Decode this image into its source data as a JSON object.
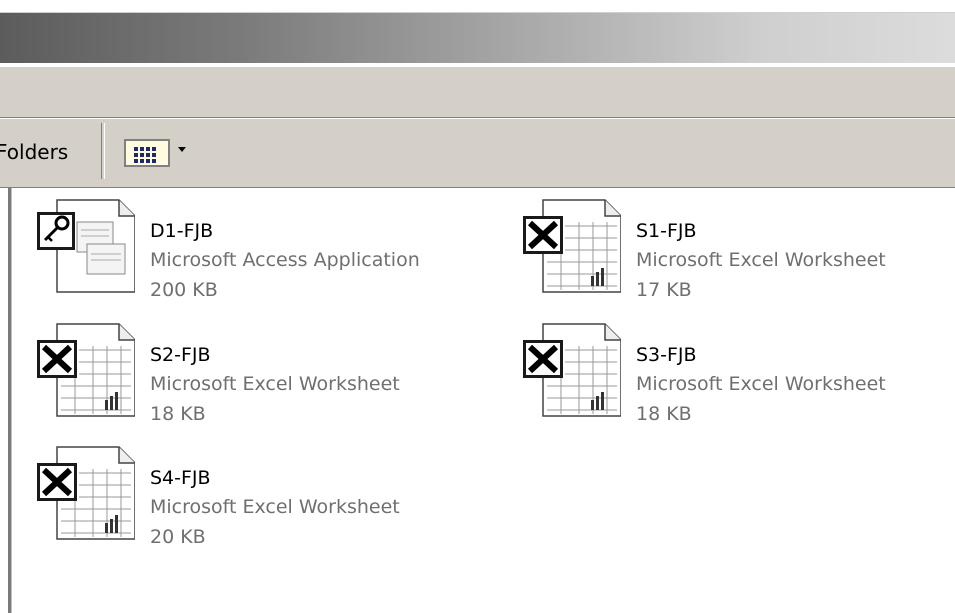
{
  "window": {
    "title_bar": ""
  },
  "toolbar": {
    "folders_label": "Folders",
    "views_icon": "views-icon"
  },
  "files": [
    {
      "name": "D1-FJB",
      "type": "Microsoft Access Application",
      "size": "200 KB",
      "icon": "access-file-icon"
    },
    {
      "name": "S1-FJB",
      "type": "Microsoft Excel Worksheet",
      "size": "17 KB",
      "icon": "excel-file-icon"
    },
    {
      "name": "S2-FJB",
      "type": "Microsoft Excel Worksheet",
      "size": "18 KB",
      "icon": "excel-file-icon"
    },
    {
      "name": "S3-FJB",
      "type": "Microsoft Excel Worksheet",
      "size": "18 KB",
      "icon": "excel-file-icon"
    },
    {
      "name": "S4-FJB",
      "type": "Microsoft Excel Worksheet",
      "size": "20 KB",
      "icon": "excel-file-icon"
    }
  ]
}
